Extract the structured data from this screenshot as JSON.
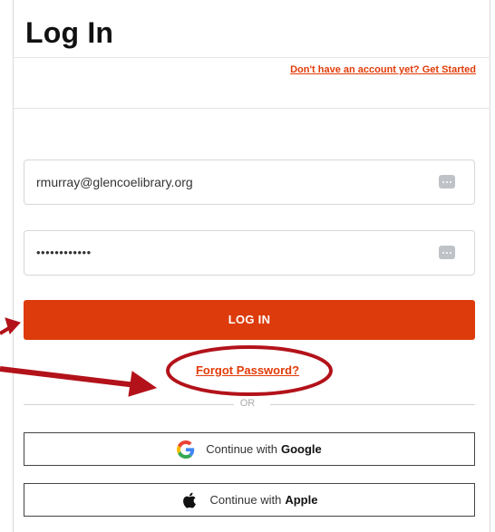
{
  "header": {
    "title": "Log In",
    "signup_link": "Don't have an account yet? Get Started"
  },
  "form": {
    "email_value": "rmurray@glencoelibrary.org",
    "password_value": "••••••••••••",
    "login_label": "LOG IN",
    "forgot_label": "Forgot Password?",
    "separator_label": "OR"
  },
  "sso": {
    "google": {
      "prefix": "Continue with",
      "provider": "Google",
      "icon": "google-icon"
    },
    "apple": {
      "prefix": "Continue with",
      "provider": "Apple",
      "icon": "apple-icon"
    }
  },
  "colors": {
    "accent": "#dd3b0b",
    "link": "#e23b08",
    "annotation": "#b3121a"
  }
}
